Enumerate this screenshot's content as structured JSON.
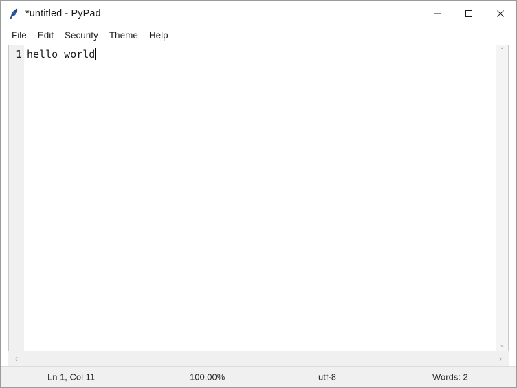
{
  "window": {
    "title": "*untitled - PyPad",
    "app_icon": "feather-quill-icon",
    "controls": {
      "minimize_label": "─",
      "maximize_label": "☐",
      "close_label": "✕",
      "minimize_name": "minimize",
      "maximize_name": "maximize",
      "close_name": "close"
    }
  },
  "menubar": {
    "items": [
      {
        "label": "File"
      },
      {
        "label": "Edit"
      },
      {
        "label": "Security"
      },
      {
        "label": "Theme"
      },
      {
        "label": "Help"
      }
    ]
  },
  "editor": {
    "gutter": {
      "line_numbers": [
        "1"
      ]
    },
    "lines": [
      "hello world"
    ],
    "caret_after_text": true
  },
  "scrollbars": {
    "vertical": {
      "up_arrow": "⌃",
      "down_arrow": "⌄"
    },
    "horizontal": {
      "left_arrow": "‹",
      "right_arrow": "›"
    }
  },
  "statusbar": {
    "position": "Ln 1, Col 11",
    "zoom": "100.00%",
    "encoding": "utf-8",
    "words": "Words: 2"
  },
  "colors": {
    "window_bg": "#ffffff",
    "chrome_bg": "#f0f0f0",
    "border": "#9b9b9b",
    "text": "#1a1a1a",
    "gutter_bg": "#f0f0f0",
    "accent_icon": "#2b57a8",
    "close_hover": "#e81123"
  }
}
